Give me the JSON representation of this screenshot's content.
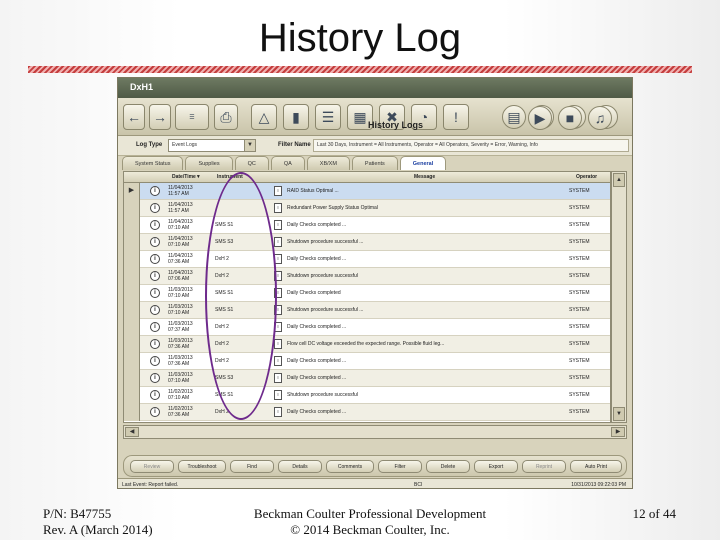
{
  "slide": {
    "title": "History Log",
    "footer_left_line1": "P/N: B47755",
    "footer_left_line2": "Rev. A (March 2014)",
    "footer_center_line1": "Beckman Coulter Professional Development",
    "footer_center_line2": "© 2014 Beckman Coulter, Inc.",
    "page": "12 of 44"
  },
  "app": {
    "name": "DxH1",
    "section_title": "History Logs",
    "log_type_label": "Log Type",
    "log_type_value": "Event Logs",
    "filter_name_label": "Filter Name",
    "filter_name_value": "Last 30 Days, Instrument = All Instruments, Operator = All Operators, Severity = Error, Warning, Info",
    "tabs": [
      "System Status",
      "Supplies",
      "QC",
      "QA",
      "XB/XM",
      "Patients",
      "General"
    ],
    "active_tab": "General",
    "columns": {
      "datetime": "Date/Time",
      "instrument": "Instrument",
      "message": "Message",
      "operator": "Operator"
    },
    "rows": [
      {
        "date": "11/04/2013",
        "time": "11:57 AM",
        "instrument": "",
        "message": "RAID Status Optimal ...",
        "operator": "SYSTEM"
      },
      {
        "date": "11/04/2013",
        "time": "11:57 AM",
        "instrument": "",
        "message": "Redundant Power Supply Status Optimal",
        "operator": "SYSTEM"
      },
      {
        "date": "11/04/2013",
        "time": "07:10 AM",
        "instrument": "SMS S1",
        "message": "Daily Checks completed ...",
        "operator": "SYSTEM"
      },
      {
        "date": "11/04/2013",
        "time": "07:10 AM",
        "instrument": "SMS S3",
        "message": "Shutdown procedure successful ...",
        "operator": "SYSTEM"
      },
      {
        "date": "11/04/2013",
        "time": "07:36 AM",
        "instrument": "DxH 2",
        "message": "Daily Checks completed ...",
        "operator": "SYSTEM"
      },
      {
        "date": "11/04/2013",
        "time": "07:06 AM",
        "instrument": "DxH 2",
        "message": "Shutdown procedure successful",
        "operator": "SYSTEM"
      },
      {
        "date": "11/03/2013",
        "time": "07:10 AM",
        "instrument": "SMS S1",
        "message": "Daily Checks completed",
        "operator": "SYSTEM"
      },
      {
        "date": "11/03/2013",
        "time": "07:10 AM",
        "instrument": "SMS S1",
        "message": "Shutdown procedure successful ...",
        "operator": "SYSTEM"
      },
      {
        "date": "11/03/2013",
        "time": "07:37 AM",
        "instrument": "DxH 2",
        "message": "Daily Checks completed ...",
        "operator": "SYSTEM"
      },
      {
        "date": "11/03/2013",
        "time": "07:36 AM",
        "instrument": "DxH 2",
        "message": "Flow cell DC voltage exceeded the expected range. Possible fluid leg...",
        "operator": "SYSTEM"
      },
      {
        "date": "11/03/2013",
        "time": "07:36 AM",
        "instrument": "DxH 2",
        "message": "Daily Checks completed ...",
        "operator": "SYSTEM"
      },
      {
        "date": "11/03/2013",
        "time": "07:10 AM",
        "instrument": "SMS S3",
        "message": "Daily Checks completed ...",
        "operator": "SYSTEM"
      },
      {
        "date": "11/02/2013",
        "time": "07:10 AM",
        "instrument": "SMS S1",
        "message": "Shutdown procedure successful",
        "operator": "SYSTEM"
      },
      {
        "date": "11/02/2013",
        "time": "07:36 AM",
        "instrument": "DxH 2",
        "message": "Daily Checks completed ...",
        "operator": "SYSTEM"
      }
    ],
    "bottom_buttons": [
      "Review",
      "Troubleshoot",
      "Find",
      "Details",
      "Comments",
      "Filter",
      "Delete",
      "Export",
      "Reprint",
      "Auto Print"
    ],
    "status_left": "Last Event: Report failed.",
    "status_mid": "BCI",
    "status_right": "10/31/2013 09:22:03 PM"
  }
}
